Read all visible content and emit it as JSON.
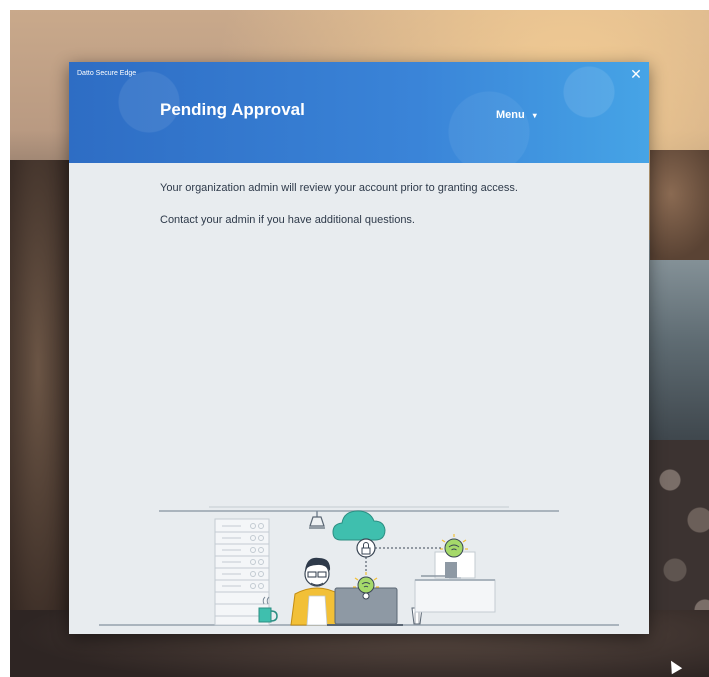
{
  "window": {
    "app_title": "Datto Secure Edge",
    "close_label": "✕",
    "page_title": "Pending Approval",
    "menu_label": "Menu",
    "menu_chevron": "▾"
  },
  "content": {
    "line1": "Your organization admin will review your account prior to granting access.",
    "line2": "Contact your admin if you have additional questions."
  },
  "colors": {
    "header_start": "#2e6dc4",
    "header_end": "#46a4e6",
    "body_background": "#e8ecef",
    "accent_green": "#3fbfae",
    "accent_yellow": "#f2c037"
  }
}
